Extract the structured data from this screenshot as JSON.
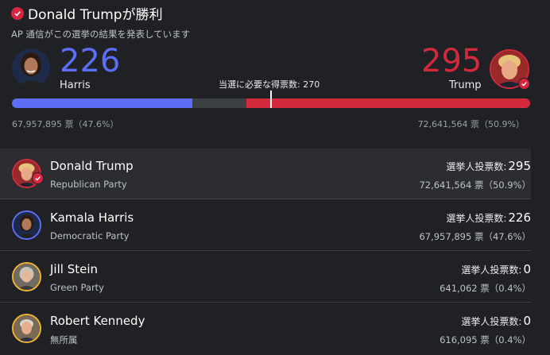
{
  "header": {
    "title": "Donald Trumpが勝利",
    "subtitle": "AP 通信がこの選挙の結果を発表しています"
  },
  "summary": {
    "harris": {
      "ev": "226",
      "label": "Harris",
      "popular": "67,957,895 票（47.6%）",
      "ev_fraction": 0.348
    },
    "trump": {
      "ev": "295",
      "label": "Trump",
      "popular": "72,641,564 票（50.9%）",
      "ev_fraction": 0.548
    },
    "threshold_label": "当選に必要な得票数: 270"
  },
  "candidates": [
    {
      "name": "Donald Trump",
      "party": "Republican Party",
      "ev_label": "選挙人投票数:",
      "ev": "295",
      "popular": "72,641,564 票（50.9%）",
      "winner": true,
      "ring_color": "#d22a3c"
    },
    {
      "name": "Kamala Harris",
      "party": "Democratic Party",
      "ev_label": "選挙人投票数:",
      "ev": "226",
      "popular": "67,957,895 票（47.6%）",
      "winner": false,
      "ring_color": "#5b6ef5"
    },
    {
      "name": "Jill Stein",
      "party": "Green Party",
      "ev_label": "選挙人投票数:",
      "ev": "0",
      "popular": "641,062 票（0.4%）",
      "winner": false,
      "ring_color": "#f2b233"
    },
    {
      "name": "Robert Kennedy",
      "party": "無所属",
      "ev_label": "選挙人投票数:",
      "ev": "0",
      "popular": "616,095 票（0.4%）",
      "winner": false,
      "ring_color": "#f2b233"
    }
  ],
  "colors": {
    "harris": "#5b6ef5",
    "trump": "#d22a3c",
    "independent": "#f2b233"
  }
}
